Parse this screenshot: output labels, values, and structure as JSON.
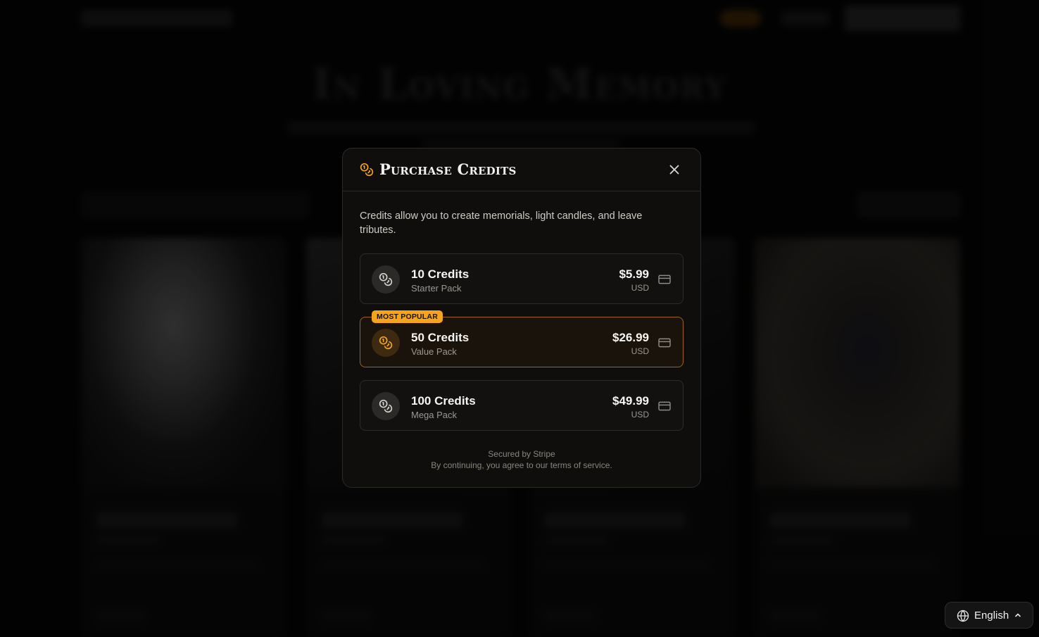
{
  "modal": {
    "title": "Purchase Credits",
    "intro": "Credits allow you to create memorials, light candles, and leave tributes.",
    "packs": [
      {
        "name": "10 Credits",
        "subtitle": "Starter Pack",
        "price": "$5.99",
        "currency": "USD",
        "popular": false
      },
      {
        "name": "50 Credits",
        "subtitle": "Value Pack",
        "price": "$26.99",
        "currency": "USD",
        "popular": true,
        "badge": "MOST POPULAR"
      },
      {
        "name": "100 Credits",
        "subtitle": "Mega Pack",
        "price": "$49.99",
        "currency": "USD",
        "popular": false
      }
    ],
    "footer_line1": "Secured by Stripe",
    "footer_line2": "By continuing, you agree to our terms of service."
  },
  "background": {
    "hero_title": "In Loving Memory"
  },
  "language": {
    "label": "English"
  },
  "colors": {
    "accent": "#f5a41b",
    "popular_border": "#9a6410",
    "modal_bg": "#0f0e0d"
  }
}
